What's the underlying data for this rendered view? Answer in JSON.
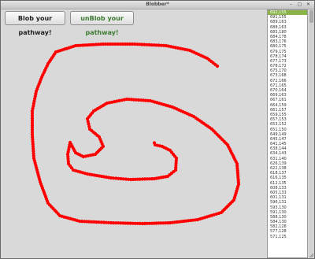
{
  "window": {
    "title": "Blobber*",
    "controls": [
      "–",
      "▢",
      "✕"
    ]
  },
  "toolbar": {
    "blob_label": "Blob your pathway!",
    "unblob_label": "unBlob your pathway!"
  },
  "colors": {
    "blob": "#ff0000",
    "accent": "#8ab34a"
  },
  "coords": [
    "692,155",
    "691,155",
    "689,163",
    "688,163",
    "685,180",
    "684,178",
    "683,176",
    "680,175",
    "679,175",
    "678,174",
    "677,173",
    "678,172",
    "675,170",
    "673,168",
    "672,166",
    "671,165",
    "670,164",
    "669,163",
    "667,161",
    "664,159",
    "661,157",
    "659,155",
    "657,153",
    "653,152",
    "651,150",
    "649,149",
    "645,147",
    "641,145",
    "638,144",
    "634,143",
    "631,140",
    "626,139",
    "622,138",
    "618,137",
    "616,135",
    "612,135",
    "608,133",
    "605,133",
    "601,131",
    "596,131",
    "593,130",
    "591,130",
    "588,130",
    "584,130",
    "582,128",
    "577,128",
    "571,125"
  ]
}
